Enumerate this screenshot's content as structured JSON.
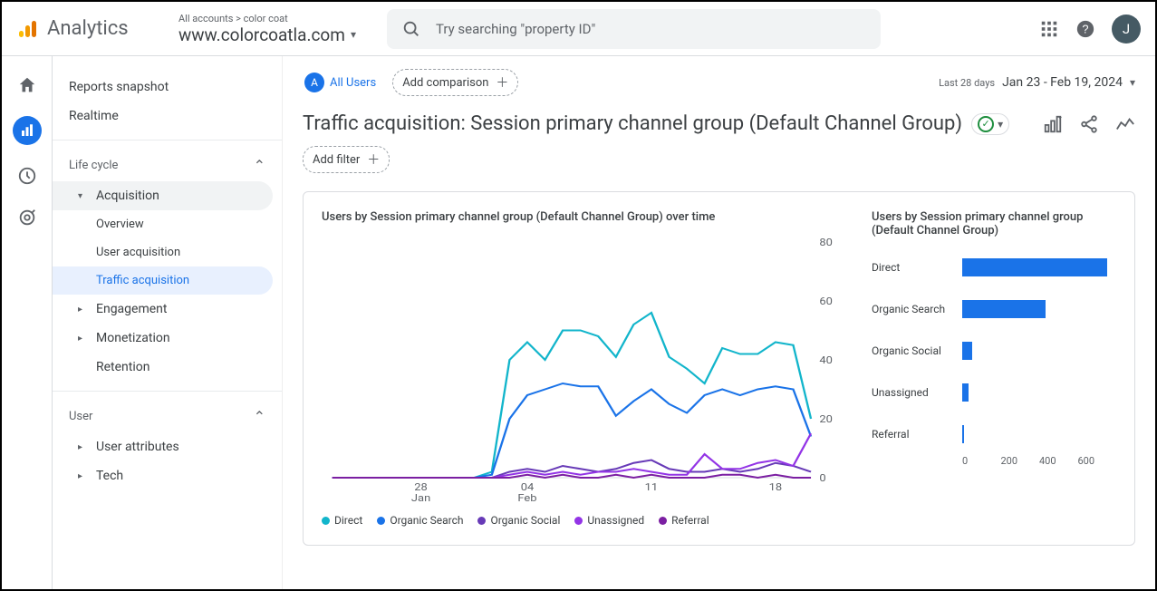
{
  "header": {
    "product": "Analytics",
    "breadcrumb_top": "All accounts > color coat",
    "breadcrumb_main": "www.colorcoatla.com",
    "search_placeholder": "Try searching \"property ID\"",
    "avatar_initial": "J"
  },
  "sidebar": {
    "top_links": [
      "Reports snapshot",
      "Realtime"
    ],
    "sections": [
      {
        "label": "Life cycle",
        "items": [
          {
            "label": "Acquisition",
            "expanded": true,
            "children": [
              "Overview",
              "User acquisition",
              "Traffic acquisition"
            ],
            "active_child": 2
          },
          {
            "label": "Engagement"
          },
          {
            "label": "Monetization"
          },
          {
            "label": "Retention"
          }
        ]
      },
      {
        "label": "User",
        "items": [
          {
            "label": "User attributes"
          },
          {
            "label": "Tech"
          }
        ]
      }
    ]
  },
  "segments": {
    "badge": "A",
    "all_users": "All Users",
    "add_comparison": "Add comparison"
  },
  "date": {
    "label": "Last 28 days",
    "range": "Jan 23 - Feb 19, 2024"
  },
  "page": {
    "title": "Traffic acquisition: Session primary channel group (Default Channel Group)",
    "add_filter": "Add filter"
  },
  "chart_data": [
    {
      "type": "line",
      "title": "Users by Session primary channel group (Default Channel Group) over time",
      "x": [
        "23",
        "24",
        "25",
        "26",
        "27",
        "28",
        "29",
        "30",
        "31",
        "01",
        "02",
        "03",
        "04",
        "05",
        "06",
        "07",
        "08",
        "09",
        "10",
        "11",
        "12",
        "13",
        "14",
        "15",
        "16",
        "17",
        "18",
        "19"
      ],
      "x_ticks": [
        {
          "pos": 5,
          "label_top": "28",
          "label_bottom": "Jan"
        },
        {
          "pos": 11,
          "label_top": "04",
          "label_bottom": "Feb"
        },
        {
          "pos": 18,
          "label_top": "11",
          "label_bottom": ""
        },
        {
          "pos": 25,
          "label_top": "18",
          "label_bottom": ""
        }
      ],
      "ylim": [
        0,
        80
      ],
      "y_ticks": [
        0,
        20,
        40,
        60,
        80
      ],
      "series": [
        {
          "name": "Direct",
          "color": "#12b5cb",
          "values": [
            0,
            0,
            0,
            0,
            0,
            0,
            0,
            0,
            0,
            2,
            40,
            46,
            40,
            50,
            50,
            48,
            41,
            52,
            56,
            41,
            37,
            32,
            44,
            42,
            42,
            46,
            45,
            20
          ]
        },
        {
          "name": "Organic Search",
          "color": "#1a73e8",
          "values": [
            0,
            0,
            0,
            0,
            0,
            0,
            0,
            0,
            0,
            1,
            20,
            28,
            30,
            32,
            31,
            31,
            21,
            26,
            30,
            25,
            22,
            28,
            30,
            28,
            30,
            31,
            30,
            14
          ]
        },
        {
          "name": "Organic Social",
          "color": "#673ab7",
          "values": [
            0,
            0,
            0,
            0,
            0,
            0,
            0,
            0,
            0,
            0,
            2,
            3,
            2,
            4,
            3,
            2,
            3,
            5,
            6,
            3,
            2,
            2,
            3,
            2,
            3,
            5,
            4,
            2
          ]
        },
        {
          "name": "Unassigned",
          "color": "#9334e6",
          "values": [
            0,
            0,
            0,
            0,
            0,
            0,
            0,
            0,
            0,
            0,
            1,
            2,
            1,
            2,
            1,
            2,
            2,
            3,
            2,
            1,
            1,
            8,
            3,
            3,
            5,
            6,
            4,
            15
          ]
        },
        {
          "name": "Referral",
          "color": "#7b1fa2",
          "values": [
            0,
            0,
            0,
            0,
            0,
            0,
            0,
            0,
            0,
            0,
            0,
            1,
            0,
            1,
            0,
            0,
            1,
            0,
            1,
            0,
            0,
            0,
            1,
            1,
            0,
            1,
            0,
            0
          ]
        }
      ]
    },
    {
      "type": "bar",
      "title": "Users by Session primary channel group (Default Channel Group)",
      "categories": [
        "Direct",
        "Organic Search",
        "Organic Social",
        "Unassigned",
        "Referral"
      ],
      "values": [
        660,
        380,
        45,
        30,
        10
      ],
      "x_ticks": [
        0,
        200,
        400,
        600
      ],
      "xlim": [
        0,
        700
      ],
      "color": "#1a73e8"
    }
  ]
}
